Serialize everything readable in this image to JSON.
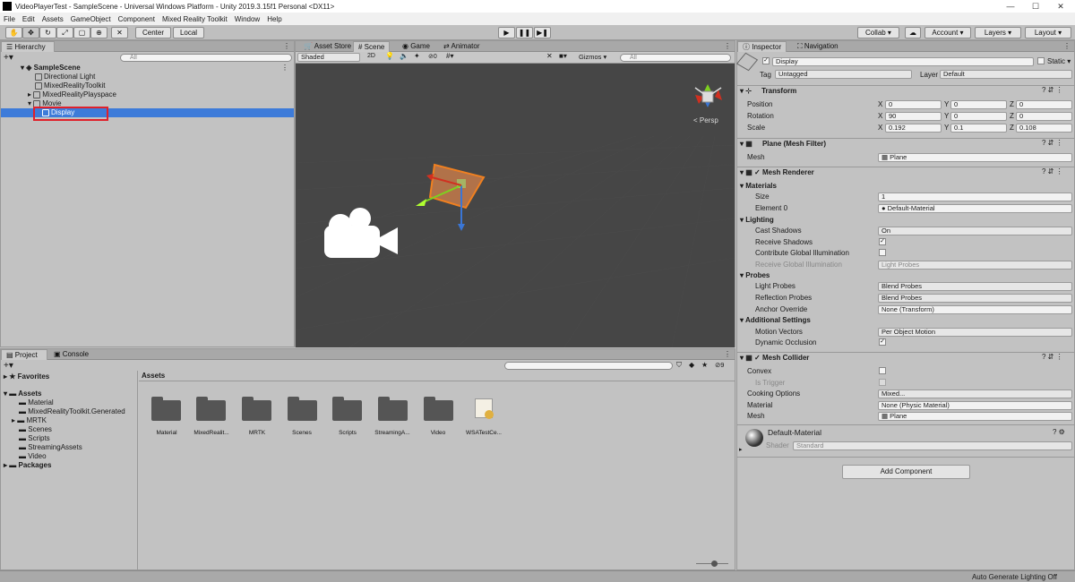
{
  "window": {
    "title": "VideoPlayerTest - SampleScene - Universal Windows Platform - Unity 2019.3.15f1 Personal <DX11>",
    "min": "—",
    "max": "☐",
    "close": "✕"
  },
  "menu": [
    "File",
    "Edit",
    "Assets",
    "GameObject",
    "Component",
    "Mixed Reality Toolkit",
    "Window",
    "Help"
  ],
  "toolbar": {
    "center": "Center",
    "local": "Local",
    "collab": "Collab ▾",
    "account": "Account ▾",
    "layers": "Layers ▾",
    "layout": "Layout ▾"
  },
  "hierarchy": {
    "tab": "Hierarchy",
    "search_placeholder": "All",
    "scene": "SampleScene",
    "items": [
      "Directional Light",
      "MixedRealityToolkit",
      "MixedRealityPlayspace",
      "Movie",
      "Display"
    ]
  },
  "scene_view": {
    "tabs": [
      "Asset Store",
      "Scene",
      "Game",
      "Animator"
    ],
    "shading": "Shaded",
    "mode_2d": "2D",
    "hidden_count": "0",
    "gizmos": "Gizmos",
    "search_placeholder": "All",
    "persp": "< Persp"
  },
  "project": {
    "tabs": [
      "Project",
      "Console"
    ],
    "favorites": "Favorites",
    "assets_root": "Assets",
    "tree": [
      "Material",
      "MixedRealityToolkit.Generated",
      "MRTK",
      "Scenes",
      "Scripts",
      "StreamingAssets",
      "Video"
    ],
    "packages": "Packages",
    "breadcrumb": "Assets",
    "badge_count": "9",
    "grid": [
      "Material",
      "MixedRealit...",
      "MRTK",
      "Scenes",
      "Scripts",
      "StreamingA...",
      "Video",
      "WSATestCe..."
    ]
  },
  "status_bar": {
    "text": "Auto Generate Lighting Off"
  },
  "inspector": {
    "tabs": [
      "Inspector",
      "Navigation"
    ],
    "object_name": "Display",
    "static": "Static ▾",
    "tag_label": "Tag",
    "tag_value": "Untagged",
    "layer_label": "Layer",
    "layer_value": "Default",
    "transform": {
      "title": "Transform",
      "position_label": "Position",
      "position": [
        "0",
        "0",
        "0"
      ],
      "rotation_label": "Rotation",
      "rotation": [
        "90",
        "0",
        "0"
      ],
      "scale_label": "Scale",
      "scale": [
        "0.192",
        "0.1",
        "0.108"
      ]
    },
    "mesh_filter": {
      "title": "Plane (Mesh Filter)",
      "mesh_label": "Mesh",
      "mesh_value": "Plane"
    },
    "mesh_renderer": {
      "title": "Mesh Renderer",
      "materials": "Materials",
      "size_label": "Size",
      "size_value": "1",
      "element0_label": "Element 0",
      "element0_value": "Default-Material",
      "lighting": "Lighting",
      "cast_shadows_label": "Cast Shadows",
      "cast_shadows_value": "On",
      "receive_shadows_label": "Receive Shadows",
      "contribute_gi_label": "Contribute Global Illumination",
      "receive_gi_label": "Receive Global Illumination",
      "receive_gi_value": "Light Probes",
      "probes": "Probes",
      "light_probes_label": "Light Probes",
      "light_probes_value": "Blend Probes",
      "reflection_probes_label": "Reflection Probes",
      "reflection_probes_value": "Blend Probes",
      "anchor_label": "Anchor Override",
      "anchor_value": "None (Transform)",
      "additional": "Additional Settings",
      "motion_label": "Motion Vectors",
      "motion_value": "Per Object Motion",
      "dynamic_occ_label": "Dynamic Occlusion"
    },
    "mesh_collider": {
      "title": "Mesh Collider",
      "convex_label": "Convex",
      "trigger_label": "Is Trigger",
      "cooking_label": "Cooking Options",
      "cooking_value": "Mixed...",
      "material_label": "Material",
      "material_value": "None (Physic Material)",
      "mesh_label": "Mesh",
      "mesh_value": "Plane"
    },
    "material": {
      "name": "Default-Material",
      "shader_label": "Shader",
      "shader_value": "Standard"
    },
    "add_component": "Add Component"
  }
}
